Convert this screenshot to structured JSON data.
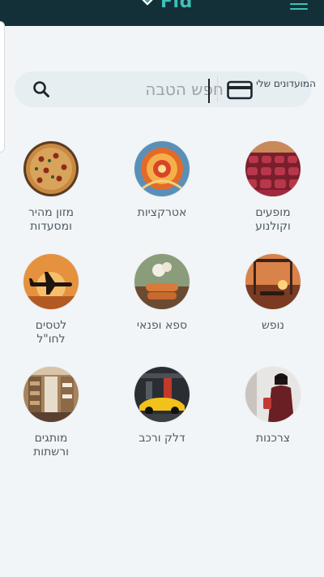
{
  "header": {
    "logo_text": "Fid"
  },
  "search": {
    "placeholder": "חפש הטבה",
    "cards_label": "המועדונים שלי"
  },
  "categories": [
    {
      "label": "מופעים\nוקולנוע"
    },
    {
      "label": "אטרקציות"
    },
    {
      "label": "מזון מהיר\nומסעדות"
    },
    {
      "label": "נופש"
    },
    {
      "label": "ספא ופנאי"
    },
    {
      "label": "לטסים\nלחו\"ל"
    },
    {
      "label": "צרכנות"
    },
    {
      "label": "דלק ורכב"
    },
    {
      "label": "מותגים\nורשתות"
    }
  ]
}
